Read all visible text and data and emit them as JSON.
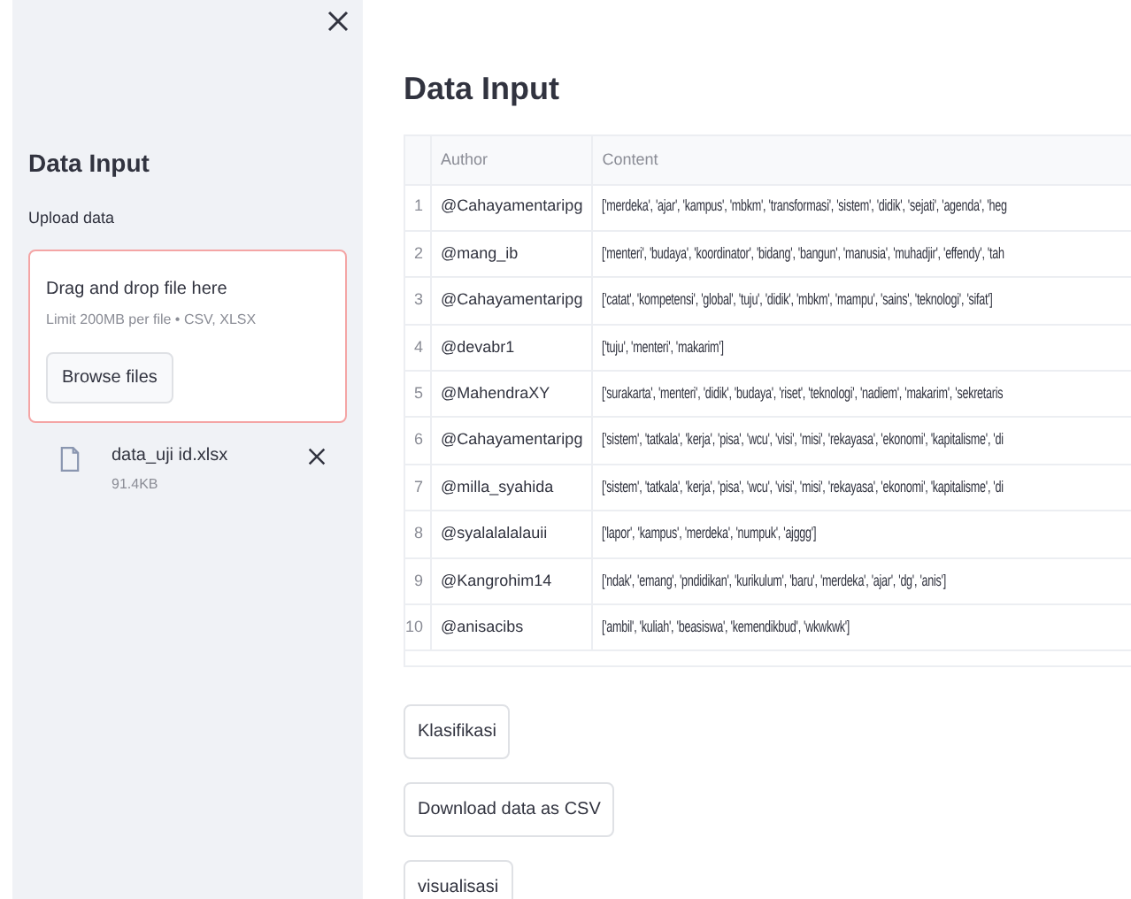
{
  "sidebar": {
    "title": "Data Input",
    "uploader": {
      "label": "Upload data",
      "drop_text": "Drag and drop file here",
      "limit_text": "Limit 200MB per file • CSV, XLSX",
      "button": "Browse files",
      "file": {
        "name": "data_uji id.xlsx",
        "size": "91.4KB"
      }
    }
  },
  "main": {
    "title": "Data Input",
    "table": {
      "columns": [
        "Author",
        "Content"
      ],
      "rows": [
        {
          "index": "1",
          "author": "@Cahayamentaripg",
          "content": "['merdeka', 'ajar', 'kampus', 'mbkm', 'transformasi', 'sistem', 'didik', 'sejati', 'agenda', 'heg"
        },
        {
          "index": "2",
          "author": "@mang_ib",
          "content": "['menteri', 'budaya', 'koordinator', 'bidang', 'bangun', 'manusia', 'muhadjir', 'effendy', 'tah"
        },
        {
          "index": "3",
          "author": "@Cahayamentaripg",
          "content": "['catat', 'kompetensi', 'global', 'tuju', 'didik', 'mbkm', 'mampu', 'sains', 'teknologi', 'sifat']"
        },
        {
          "index": "4",
          "author": "@devabr1",
          "content": "['tuju', 'menteri', 'makarim']"
        },
        {
          "index": "5",
          "author": "@MahendraXY",
          "content": "['surakarta', 'menteri', 'didik', 'budaya', 'riset', 'teknologi', 'nadiem', 'makarim', 'sekretaris"
        },
        {
          "index": "6",
          "author": "@Cahayamentaripg",
          "content": "['sistem', 'tatkala', 'kerja', 'pisa', 'wcu', 'visi', 'misi', 'rekayasa', 'ekonomi', 'kapitalisme', 'di"
        },
        {
          "index": "7",
          "author": "@milla_syahida",
          "content": "['sistem', 'tatkala', 'kerja', 'pisa', 'wcu', 'visi', 'misi', 'rekayasa', 'ekonomi', 'kapitalisme', 'di"
        },
        {
          "index": "8",
          "author": "@syalalalalauii",
          "content": "['lapor', 'kampus', 'merdeka', 'numpuk', 'ajggg']"
        },
        {
          "index": "9",
          "author": "@Kangrohim14",
          "content": "['ndak', 'emang', 'pndidikan', 'kurikulum', 'baru', 'merdeka', 'ajar', 'dg', 'anis']"
        },
        {
          "index": "10",
          "author": "@anisacibs",
          "content": "['ambil', 'kuliah', 'beasiswa', 'kemendikbud', 'wkwkwk']"
        }
      ]
    },
    "buttons": [
      "Klasifikasi",
      "Download data as CSV",
      "visualisasi"
    ]
  }
}
